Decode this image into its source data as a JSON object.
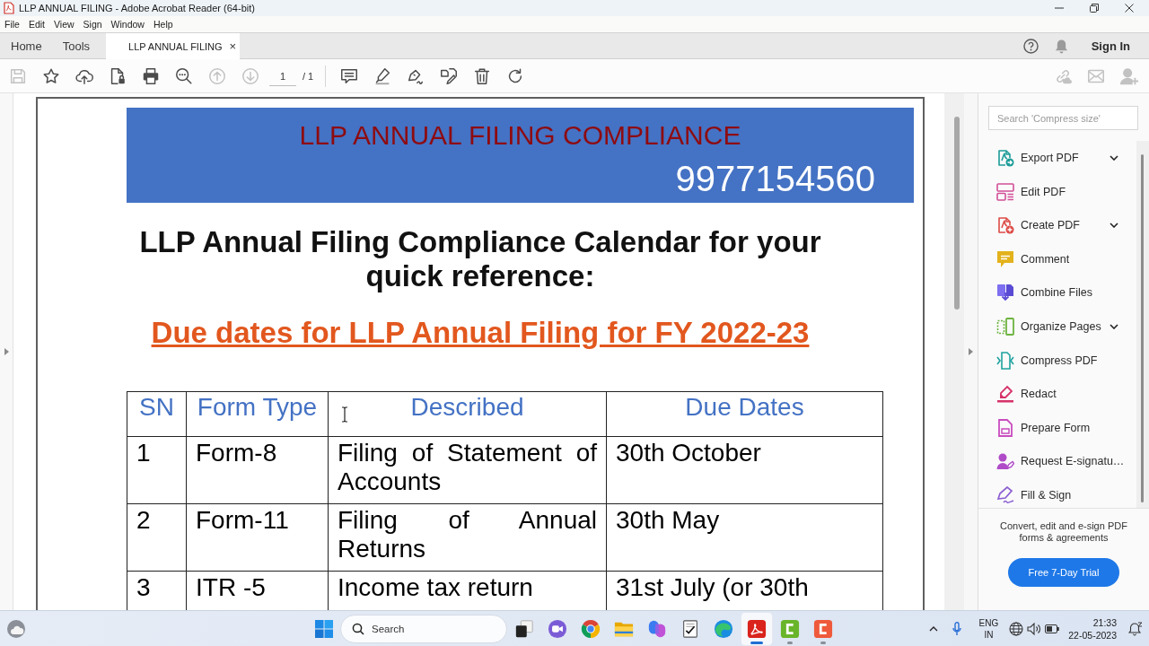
{
  "window": {
    "title": "LLP ANNUAL FILING - Adobe Acrobat Reader (64-bit)"
  },
  "menu": [
    "File",
    "Edit",
    "View",
    "Sign",
    "Window",
    "Help"
  ],
  "tabs": [
    {
      "label": "Home",
      "selected": false
    },
    {
      "label": "Tools",
      "selected": false
    },
    {
      "label": "LLP ANNUAL FILING",
      "selected": true,
      "close": "×"
    }
  ],
  "account": {
    "sign_in": "Sign In"
  },
  "toolbar": {
    "file_buttons": [
      {
        "disabled": true
      },
      {
        "disabled": false
      },
      {
        "disabled": false
      },
      {
        "disabled": false
      },
      {
        "disabled": false
      },
      {
        "disabled": false
      },
      {
        "disabled": true
      },
      {
        "disabled": true
      }
    ],
    "page": {
      "current": "1",
      "total": "/ 1"
    },
    "edit_buttons": [
      {
        "disabled": false
      },
      {
        "disabled": false
      },
      {
        "disabled": false
      },
      {
        "disabled": false
      },
      {
        "disabled": false
      },
      {
        "disabled": false
      }
    ],
    "share_buttons": [
      {
        "disabled": true
      },
      {
        "disabled": true
      },
      {
        "disabled": true
      }
    ]
  },
  "document": {
    "banner": {
      "title": "LLP ANNUAL FILING COMPLIANCE",
      "phone": "9977154560"
    },
    "heading": "LLP Annual Filing Compliance Calendar for your quick reference:",
    "subheading": "Due dates for LLP Annual Filing for FY 2022-23",
    "table": {
      "columns": [
        "SN",
        "Form Type",
        "Described",
        "Due Dates"
      ],
      "rows": [
        [
          "1",
          "Form-8",
          "Filing of Statement of Accounts",
          "30th October"
        ],
        [
          "2",
          "Form-11",
          "Filing of Annual Returns",
          "30th May"
        ],
        [
          "3",
          "ITR -5",
          "Income tax return",
          "31st July (or 30th"
        ]
      ]
    }
  },
  "tools_panel": {
    "search": {
      "placeholder": "Search 'Compress size'"
    },
    "items": [
      {
        "label": "Export PDF",
        "expandable": true
      },
      {
        "label": "Edit PDF",
        "expandable": false
      },
      {
        "label": "Create PDF",
        "expandable": true
      },
      {
        "label": "Comment",
        "expandable": false
      },
      {
        "label": "Combine Files",
        "expandable": false
      },
      {
        "label": "Organize Pages",
        "expandable": true
      },
      {
        "label": "Compress PDF",
        "expandable": false
      },
      {
        "label": "Redact",
        "expandable": false
      },
      {
        "label": "Prepare Form",
        "expandable": false
      },
      {
        "label": "Request E-signatu…",
        "expandable": false
      },
      {
        "label": "Fill & Sign",
        "expandable": false
      }
    ],
    "promo": "Convert, edit and e-sign PDF forms & agreements",
    "trial_button": "Free 7-Day Trial"
  },
  "taskbar": {
    "search": {
      "placeholder": "Search"
    },
    "apps": [
      {
        "running": false,
        "selected": false
      },
      {
        "running": false,
        "selected": false
      },
      {
        "running": false,
        "selected": false
      },
      {
        "running": false,
        "selected": false
      },
      {
        "running": false,
        "selected": false
      },
      {
        "running": false,
        "selected": false
      },
      {
        "running": false,
        "selected": false
      },
      {
        "running": true,
        "selected": true
      },
      {
        "running": true,
        "selected": false
      },
      {
        "running": true,
        "selected": false
      }
    ],
    "tray": {
      "language": "ENG",
      "region": "IN",
      "time": "21:33",
      "date": "22-05-2023"
    }
  }
}
